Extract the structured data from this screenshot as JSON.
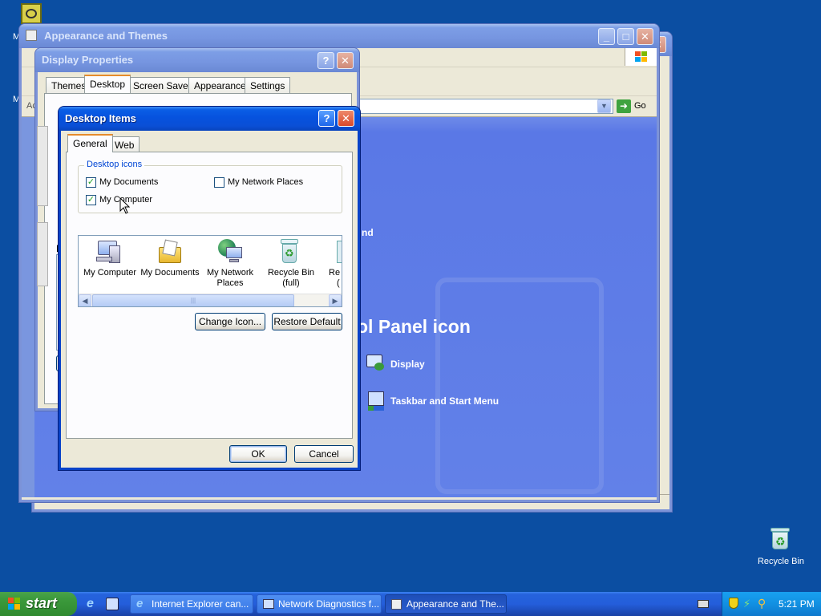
{
  "desktop": {
    "top_icon_label": "M",
    "recycle_bin_label": "Recycle Bin"
  },
  "appearance_window": {
    "title": "Appearance and Themes",
    "address_go_label": "Go",
    "address_prefix": "Ac",
    "category_partial": "nd",
    "control_panel_heading": "ol Panel icon",
    "links": [
      {
        "label": "Display"
      },
      {
        "label": "Taskbar and Start Menu"
      }
    ]
  },
  "display_properties": {
    "title": "Display Properties",
    "tabs": [
      "Themes",
      "Desktop",
      "Screen Saver",
      "Appearance",
      "Settings"
    ],
    "active_tab": "Desktop",
    "side_letter": "B"
  },
  "desktop_items": {
    "title": "Desktop Items",
    "tabs": [
      "General",
      "Web"
    ],
    "group_label": "Desktop icons",
    "checkboxes": [
      {
        "label": "My Documents",
        "checked": true
      },
      {
        "label": "My Network Places",
        "checked": false
      },
      {
        "label": "My Computer",
        "checked": true
      }
    ],
    "icons": [
      {
        "label": "My Computer",
        "label2": ""
      },
      {
        "label": "My Documents",
        "label2": ""
      },
      {
        "label": "My Network",
        "label2": "Places"
      },
      {
        "label": "Recycle Bin",
        "label2": "(full)"
      },
      {
        "label": "Re",
        "label2": "("
      }
    ],
    "change_icon_label": "Change Icon...",
    "restore_default_label": "Restore Default",
    "ok_label": "OK",
    "cancel_label": "Cancel"
  },
  "taskbar": {
    "start_label": "start",
    "tasks": [
      {
        "label": "Internet Explorer can..."
      },
      {
        "label": "Network Diagnostics f..."
      },
      {
        "label": "Appearance and The..."
      }
    ],
    "clock": "5:21 PM"
  },
  "colors": {
    "desktop": "#0b4ea2",
    "titlebar_active": "#0652de",
    "control_panel_blue": "#5a78e6",
    "window_face": "#ece9d8"
  }
}
